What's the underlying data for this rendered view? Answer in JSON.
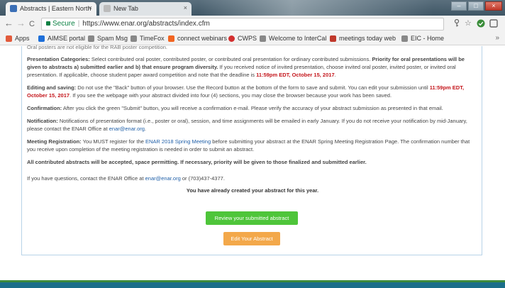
{
  "browser": {
    "tabs": [
      {
        "title": "Abstracts | Eastern North",
        "active": true
      },
      {
        "title": "New Tab",
        "active": false
      }
    ],
    "window_controls": {
      "minimize": "–",
      "maximize": "□",
      "close": "×"
    },
    "toolbar": {
      "back": "←",
      "forward": "→",
      "reload": "C",
      "secure_label": "Secure",
      "url": "https://www.enar.org/abstracts/index.cfm"
    },
    "bookmarks": [
      {
        "label": "Apps",
        "color": "#e25b3c"
      },
      {
        "label": "AIMSE portal",
        "color": "#1e6fd9"
      },
      {
        "label": "Spam Msg",
        "color": "#888888"
      },
      {
        "label": "TimeFox",
        "color": "#888888"
      },
      {
        "label": "connect webinars",
        "color": "#f26522"
      },
      {
        "label": "CWPS",
        "color": "#d32f2f"
      },
      {
        "label": "Welcome to InterCal",
        "color": "#888888"
      },
      {
        "label": "meetings today web",
        "color": "#c0392b"
      },
      {
        "label": "EIC - Home",
        "color": "#888888"
      }
    ],
    "more": "»"
  },
  "content": {
    "cutoff_line": "Oral posters are not eligible for the RAB poster competition.",
    "categories": {
      "label": "Presentation Categories:",
      "text1": " Select contributed oral poster, contributed poster, or contributed oral presentation for ordinary contributed submissions. ",
      "bold": "Priority for oral presentations will be given to abstracts a) submitted earlier and b) that ensure program diversity.",
      "text2": " If you received notice of invited presentation, choose invited oral poster, invited poster, or invited oral presentation. If applicable, choose student paper award competition and note that the deadline is ",
      "deadline": "11:59pm EDT, October 15, 2017",
      "end": "."
    },
    "editing": {
      "label": "Editing and saving:",
      "text1": " Do not use the \"Back\" button of your browser. Use the Record button at the bottom of the form to save and submit. You can edit your submission until ",
      "deadline": "11:59pm EDT, October 15, 2017",
      "text2": ". If you see the webpage with your abstract divided into four (4) sections, you may close the browser because your work has been saved."
    },
    "confirmation": {
      "label": "Confirmation:",
      "text": " After you click the green \"Submit\" button, you will receive a confirmation e-mail. Please verify the accuracy of your abstract submission as presented in that email."
    },
    "notification": {
      "label": "Notification:",
      "text": " Notifications of presentation format (i.e., poster or oral), session, and time assignments will be emailed in early January. If you do not receive your notification by mid-January, please contact the ENAR Office at ",
      "email": "enar@enar.org",
      "end": "."
    },
    "registration": {
      "label": "Meeting Registration:",
      "text1": " You MUST register for the ",
      "link": "ENAR 2018 Spring Meeting",
      "text2": " before submitting your abstract at the ENAR Spring Meeting Registration Page. The confirmation number that you receive upon completion of the meeting registration is needed in order to submit an abstract."
    },
    "accepted": "All contributed abstracts will be accepted, space permitting. If necessary, priority will be given to those finalized and submitted earlier.",
    "contact": {
      "text1": "If you have questions, contact the ENAR Office at ",
      "email": "enar@enar.org",
      "text2": " or (703)437-4377."
    },
    "already_created": "You have already created your abstract for this year.",
    "review_button": "Review your submitted abstract",
    "edit_button": "Edit Your Abstract"
  }
}
